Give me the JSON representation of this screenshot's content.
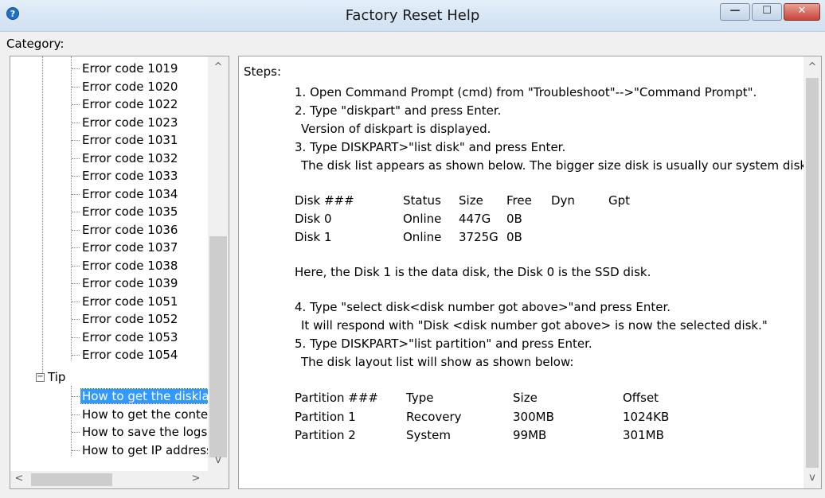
{
  "window": {
    "title": "Factory Reset Help",
    "icon": "help-icon",
    "buttons": {
      "minimize": "—",
      "maximize": "☐",
      "close": "✕"
    }
  },
  "category_label": "Category:",
  "tree": {
    "error_items": [
      "Error code 1019",
      "Error code 1020",
      "Error code 1022",
      "Error code 1023",
      "Error code 1031",
      "Error code 1032",
      "Error code 1033",
      "Error code 1034",
      "Error code 1035",
      "Error code 1036",
      "Error code 1037",
      "Error code 1038",
      "Error code 1039",
      "Error code 1051",
      "Error code 1052",
      "Error code 1053",
      "Error code 1054"
    ],
    "tip_label": "Tip",
    "tip_items": [
      "How to get the diskla",
      "How to get the conte",
      "How to save the logs?",
      "How to get IP address"
    ],
    "selected_tip_index": 0
  },
  "content": {
    "steps_label": "Steps:",
    "lines": [
      "1. Open Command Prompt (cmd) from \"Troubleshoot\"-->\"Command Prompt\".",
      "2. Type \"diskpart\" and press Enter.",
      "Version of diskpart is displayed.",
      "3. Type DISKPART>\"list disk\" and press Enter.",
      "The disk list appears as shown below. The bigger size disk is usually our system disk."
    ],
    "disk_table": {
      "headers": [
        "Disk ###",
        "Status",
        "Size",
        "Free",
        "Dyn",
        "Gpt"
      ],
      "rows": [
        [
          "Disk 0",
          "Online",
          "447G",
          "0B"
        ],
        [
          "Disk 1",
          "Online",
          "3725G",
          "0B"
        ]
      ]
    },
    "note": "Here, the Disk 1 is the data disk, the Disk 0 is the SSD disk.",
    "lines2": [
      "4. Type \"select disk<disk number got above>\"and press Enter.",
      "It will respond with \"Disk <disk number got above> is now the selected disk.\"",
      "5. Type DISKPART>\"list partition\" and press Enter.",
      "The disk layout list will show as shown below:"
    ],
    "partition_table": {
      "headers": [
        "Partition ###",
        "Type",
        "Size",
        "Offset"
      ],
      "rows": [
        [
          "Partition 1",
          "Recovery",
          "300MB",
          "1024KB"
        ],
        [
          "Partition 2",
          "System",
          "99MB",
          "301MB"
        ]
      ]
    }
  },
  "scroll_arrows": {
    "up": "^",
    "down": "v",
    "left": "<",
    "right": ">"
  }
}
